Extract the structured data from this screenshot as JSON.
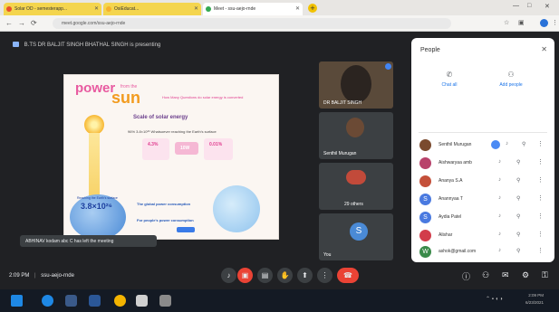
{
  "browser": {
    "tabs": [
      {
        "label": "Solar OD - semesterapp..."
      },
      {
        "label": "OsiEducat..."
      },
      {
        "label": "Meet - ssu-aejo-rnde"
      }
    ],
    "url": "meet.google.com/ssu-aejo-rnde",
    "new_tab": "+"
  },
  "meet": {
    "presenting_text": "B.TS DR BALJIT SINGH BHATHAL SINGH is presenting",
    "toast": "ABHINAV kodam abc C has left the meeting",
    "clock": "2:09 PM",
    "meeting_code": "ssu-aejo-rnde"
  },
  "slide": {
    "title_power": "power",
    "title_from": "from the",
    "title_sun": "sun",
    "subtitle": "How Many Questions do solar energy is converted",
    "scale_heading": "Scale of solar energy",
    "scale_line": "96%  3.8×10²⁶ Whatsoever reaching the Earth's surface",
    "pct_left": "4.3%",
    "pct_right": "0.01%",
    "pill": "10W",
    "big_value": "3.8×10²⁶",
    "reaching_label": "Reaching the Earth's surface",
    "global_power": "The global power consumption",
    "people_power": "For people's power consumption"
  },
  "tiles": [
    {
      "name": "DR BALJIT SINGH"
    },
    {
      "name": "Senthil Murugan"
    },
    {
      "name": "29 others"
    },
    {
      "name": "You",
      "initial": "S"
    }
  ],
  "people_panel": {
    "title": "People",
    "add_label": "Add people",
    "chat_label": "Chat all",
    "participants": [
      {
        "name": "Senthil Murugan",
        "color": "#7a4a2e",
        "initial": ""
      },
      {
        "name": "Aishwaryaa amb",
        "color": "#b8426b",
        "initial": ""
      },
      {
        "name": "Ananya S.A",
        "color": "#c4503a",
        "initial": ""
      },
      {
        "name": "Anannyaa T",
        "color": "#4a7ae0",
        "initial": "S"
      },
      {
        "name": "Aydia Patel",
        "color": "#4a7ae0",
        "initial": "S"
      },
      {
        "name": "Alishar",
        "color": "#d23c4a",
        "initial": ""
      },
      {
        "name": "ashok@gmail.com",
        "color": "#3a8a4a",
        "initial": "W"
      }
    ]
  },
  "taskbar": {
    "time": "2:09 PM",
    "date": "6/23/2021"
  }
}
